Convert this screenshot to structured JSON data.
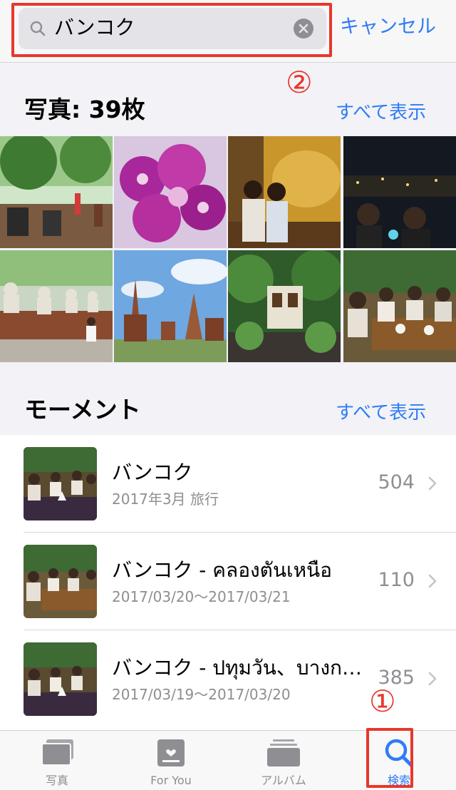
{
  "search": {
    "query": "バンコク",
    "cancel_label": "キャンセル"
  },
  "annotations": {
    "badge_1": "①",
    "badge_2": "②"
  },
  "photos_section": {
    "title": "写真: 39枚",
    "see_all": "すべて表示",
    "thumbnails": [
      "garden-restaurant",
      "purple-orchids",
      "reclining-buddha-selfie",
      "night-rooftop-bar",
      "buddha-statues-girl",
      "ayutthaya-ruins",
      "tropical-courtyard",
      "family-dinner-table"
    ]
  },
  "moments_section": {
    "title": "モーメント",
    "see_all": "すべて表示",
    "items": [
      {
        "title": "バンコク",
        "subtitle": "2017年3月 旅行",
        "count": "504"
      },
      {
        "title": "バンコク - คลองตันเหนือ",
        "subtitle": "2017/03/20〜2017/03/21",
        "count": "110"
      },
      {
        "title": "バンコク - ปทุมวัน、บางก…",
        "subtitle": "2017/03/19〜2017/03/20",
        "count": "385"
      }
    ]
  },
  "tabbar": {
    "tabs": [
      {
        "label": "写真",
        "icon": "photos-icon",
        "active": false
      },
      {
        "label": "For You",
        "icon": "for-you-icon",
        "active": false
      },
      {
        "label": "アルバム",
        "icon": "albums-icon",
        "active": false
      },
      {
        "label": "検索",
        "icon": "search-icon",
        "active": true
      }
    ]
  },
  "colors": {
    "accent": "#2e7cf6",
    "highlight": "#e8372b",
    "secondary_text": "#8e8e93"
  }
}
